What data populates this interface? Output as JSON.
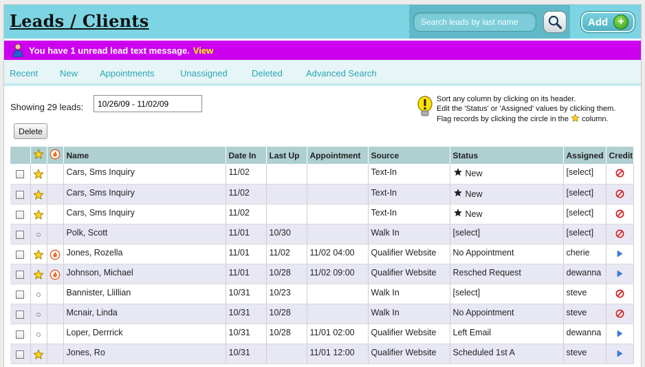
{
  "header": {
    "title": "Leads / Clients",
    "search_placeholder": "Search leads by last name",
    "add_label": "Add"
  },
  "message_bar": {
    "text": "You have 1 unread lead text message.",
    "link_label": "View"
  },
  "nav": {
    "items": [
      "Recent",
      "New",
      "Appointments",
      "Unassigned",
      "Deleted",
      "Advanced Search"
    ]
  },
  "toolbar": {
    "showing_label": "Showing 29 leads:",
    "date_range_value": "10/26/09 - 11/02/09",
    "delete_label": "Delete"
  },
  "hint": {
    "line1": "Sort any column by clicking on its header.",
    "line2": "Edit the 'Status' or 'Assigned' values by clicking them.",
    "line3a": "Flag records by clicking the circle in the",
    "line3b": "column."
  },
  "table": {
    "columns": [
      "Name",
      "Date In",
      "Last Up",
      "Appointment",
      "Source",
      "Status",
      "Assigned",
      "Credit"
    ],
    "rows": [
      {
        "star": true,
        "flame": false,
        "name": "Cars, Sms Inquiry",
        "date_in": "11/02",
        "last_up": "",
        "appointment": "",
        "source": "Text-In",
        "status_star": true,
        "status": "New",
        "assigned": "[select]",
        "credit": "no"
      },
      {
        "star": true,
        "flame": false,
        "name": "Cars, Sms Inquiry",
        "date_in": "11/02",
        "last_up": "",
        "appointment": "",
        "source": "Text-In",
        "status_star": true,
        "status": "New",
        "assigned": "[select]",
        "credit": "no"
      },
      {
        "star": true,
        "flame": false,
        "name": "Cars, Sms Inquiry",
        "date_in": "11/02",
        "last_up": "",
        "appointment": "",
        "source": "Text-In",
        "status_star": true,
        "status": "New",
        "assigned": "[select]",
        "credit": "no"
      },
      {
        "star": false,
        "flame": false,
        "name": "Polk, Scott",
        "date_in": "11/01",
        "last_up": "10/30",
        "appointment": "",
        "source": "Walk In",
        "status_star": false,
        "status": "[select]",
        "assigned": "[select]",
        "credit": "no"
      },
      {
        "star": true,
        "flame": true,
        "name": "Jones, Rozella",
        "date_in": "11/01",
        "last_up": "11/02",
        "appointment": "11/02 04:00",
        "source": "Qualifier Website",
        "status_star": false,
        "status": "No Appointment",
        "assigned": "cherie",
        "credit": "go"
      },
      {
        "star": true,
        "flame": true,
        "name": "Johnson, Michael",
        "date_in": "11/01",
        "last_up": "10/28",
        "appointment": "11/02 09:00",
        "source": "Qualifier Website",
        "status_star": false,
        "status": "Resched Request",
        "assigned": "dewanna",
        "credit": "go"
      },
      {
        "star": false,
        "flame": false,
        "name": "Bannister, Llillian",
        "date_in": "10/31",
        "last_up": "10/23",
        "appointment": "",
        "source": "Walk In",
        "status_star": false,
        "status": "[select]",
        "assigned": "steve",
        "credit": "no"
      },
      {
        "star": false,
        "flame": false,
        "name": "Mcnair, Linda",
        "date_in": "10/31",
        "last_up": "10/28",
        "appointment": "",
        "source": "Walk In",
        "status_star": false,
        "status": "No Appointment",
        "assigned": "steve",
        "credit": "no"
      },
      {
        "star": false,
        "flame": false,
        "name": "Loper, Derrrick",
        "date_in": "10/31",
        "last_up": "10/28",
        "appointment": "11/01 02:00",
        "source": "Qualifier Website",
        "status_star": false,
        "status": "Left Email",
        "assigned": "dewanna",
        "credit": "go"
      },
      {
        "star": true,
        "flame": false,
        "name": "Jones, Ro",
        "date_in": "10/31",
        "last_up": "",
        "appointment": "11/01 12:00",
        "source": "Qualifier Website",
        "status_star": false,
        "status": "Scheduled 1st A",
        "assigned": "steve",
        "credit": "go"
      }
    ]
  },
  "colors": {
    "header_bg": "#7dd5e3",
    "message_bg": "#cc00ee",
    "nav_link": "#2ba6b4",
    "table_header_bg": "#afcfd1",
    "row_alt_bg": "#e8e8f4"
  },
  "icons": {
    "search": "magnifier-icon",
    "add": "plus-circle-icon",
    "message": "person-icon",
    "hint": "lightbulb-icon",
    "star": "star-icon",
    "flame": "flame-icon",
    "credit_no": "no-entry-icon",
    "credit_go": "play-arrow-icon"
  }
}
